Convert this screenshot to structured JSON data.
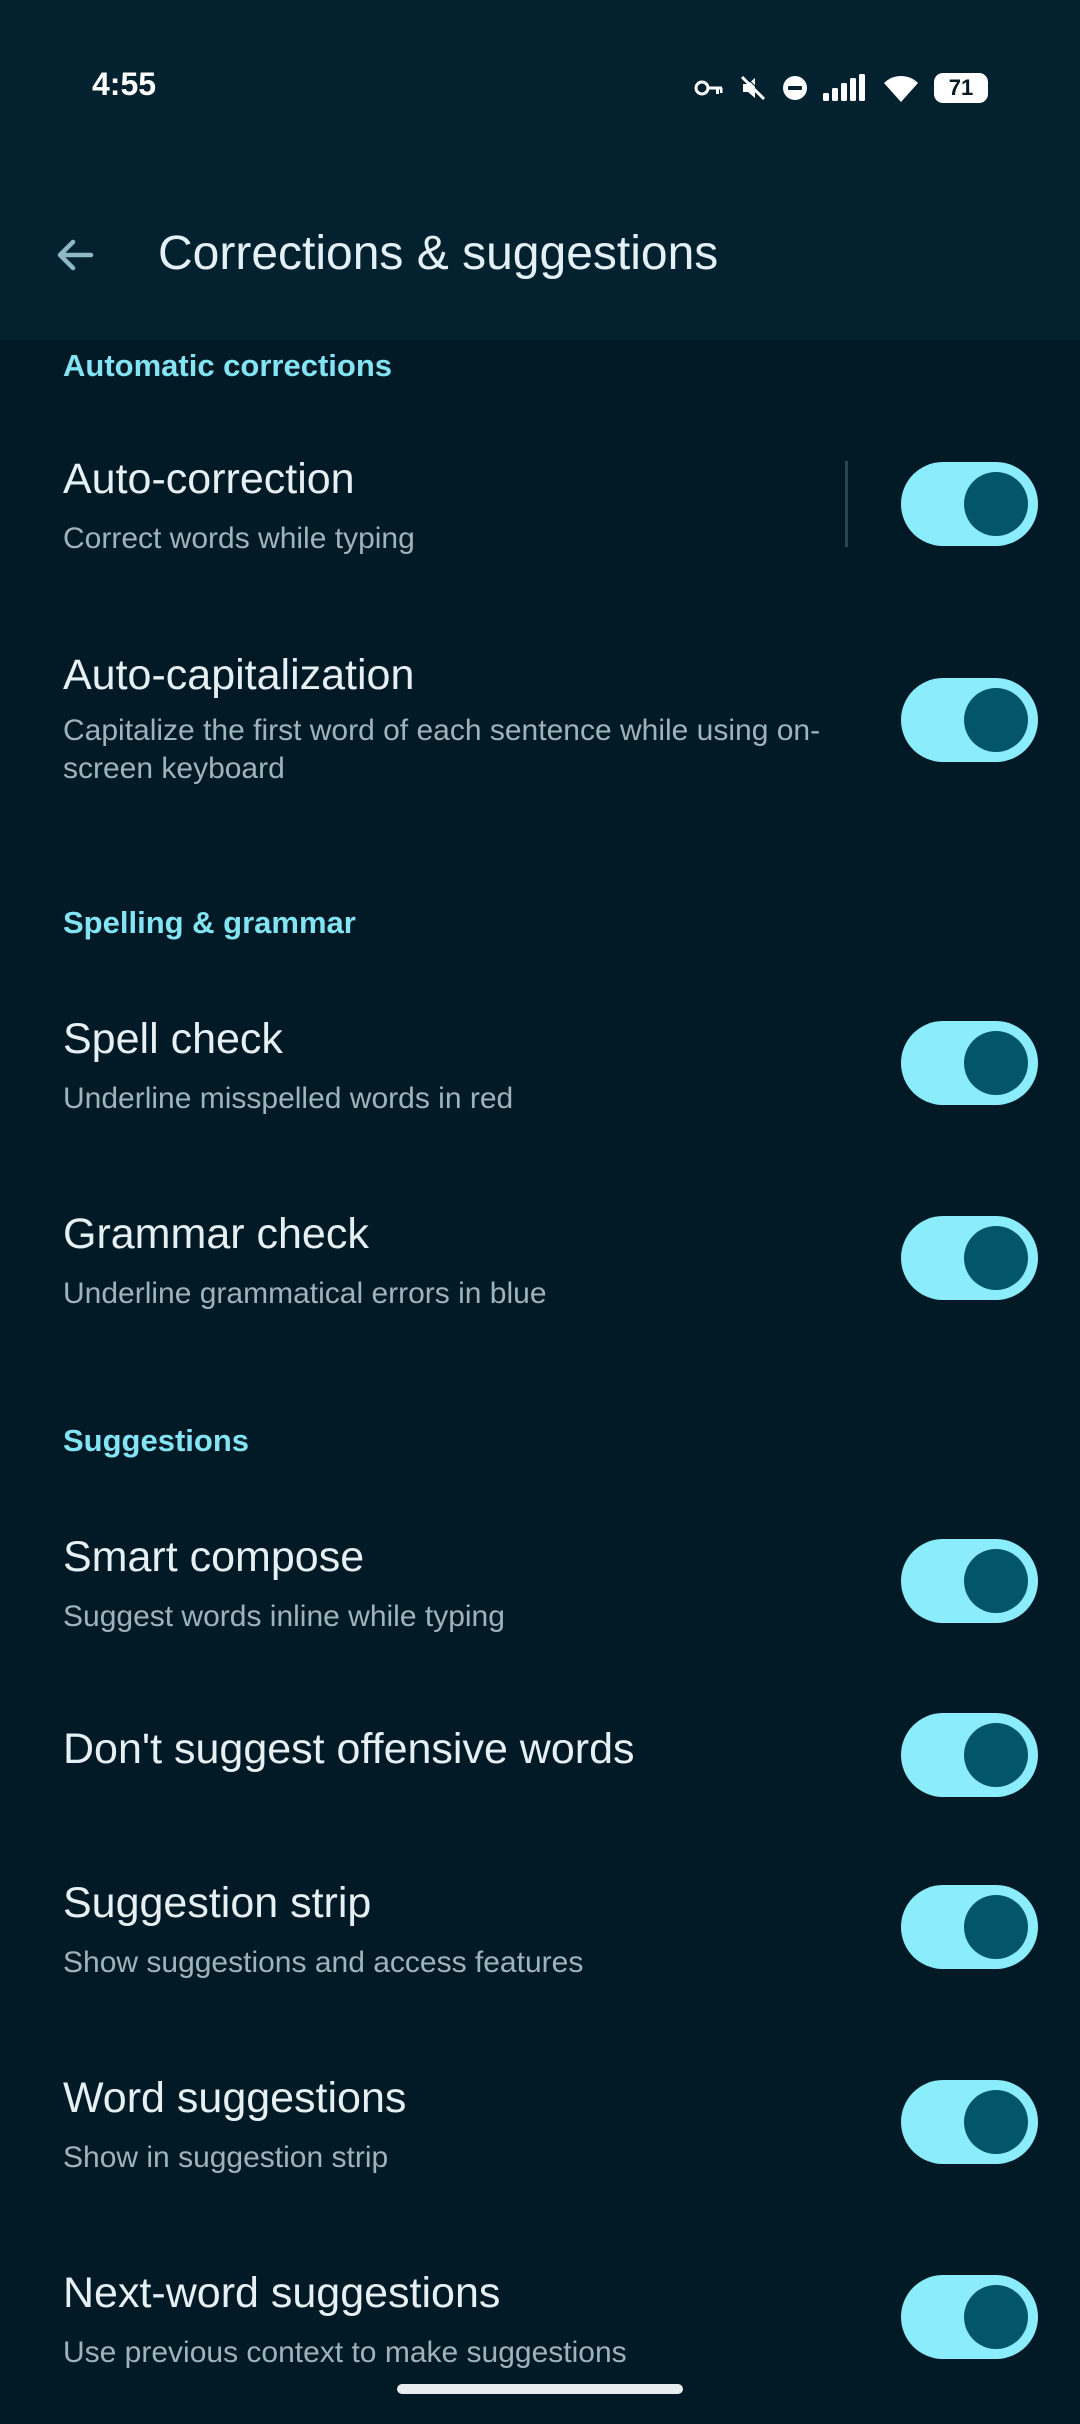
{
  "status_bar": {
    "time": "4:55",
    "battery": "71",
    "icons": [
      "vpn-key-icon",
      "mute-icon",
      "dnd-icon",
      "signal-icon",
      "wifi-icon",
      "battery-icon"
    ]
  },
  "header": {
    "title": "Corrections & suggestions",
    "back_icon": "arrow-left-icon"
  },
  "sections": {
    "automatic": "Automatic corrections",
    "spelling": "Spelling & grammar",
    "suggestions": "Suggestions"
  },
  "settings": {
    "auto_correction": {
      "title": "Auto-correction",
      "subtitle": "Correct words while typing",
      "enabled": true
    },
    "auto_capitalization": {
      "title": "Auto-capitalization",
      "subtitle": "Capitalize the first word of each sentence while using on-screen keyboard",
      "enabled": true
    },
    "spell_check": {
      "title": "Spell check",
      "subtitle": "Underline misspelled words in red",
      "enabled": true
    },
    "grammar_check": {
      "title": "Grammar check",
      "subtitle": "Underline grammatical errors in blue",
      "enabled": true
    },
    "smart_compose": {
      "title": "Smart compose",
      "subtitle": "Suggest words inline while typing",
      "enabled": true
    },
    "offensive_words": {
      "title": "Don't suggest offensive words",
      "enabled": true
    },
    "suggestion_strip": {
      "title": "Suggestion strip",
      "subtitle": "Show suggestions and access features",
      "enabled": true
    },
    "word_suggestions": {
      "title": "Word suggestions",
      "subtitle": "Show in suggestion strip",
      "enabled": true
    },
    "next_word": {
      "title": "Next-word suggestions",
      "subtitle": "Use previous context to make suggestions",
      "enabled": true
    }
  },
  "colors": {
    "background": "#021a26",
    "toolbar": "#04212f",
    "accent": "#83e4f4",
    "toggle_track": "#8bedfb",
    "toggle_thumb": "#03566a"
  }
}
